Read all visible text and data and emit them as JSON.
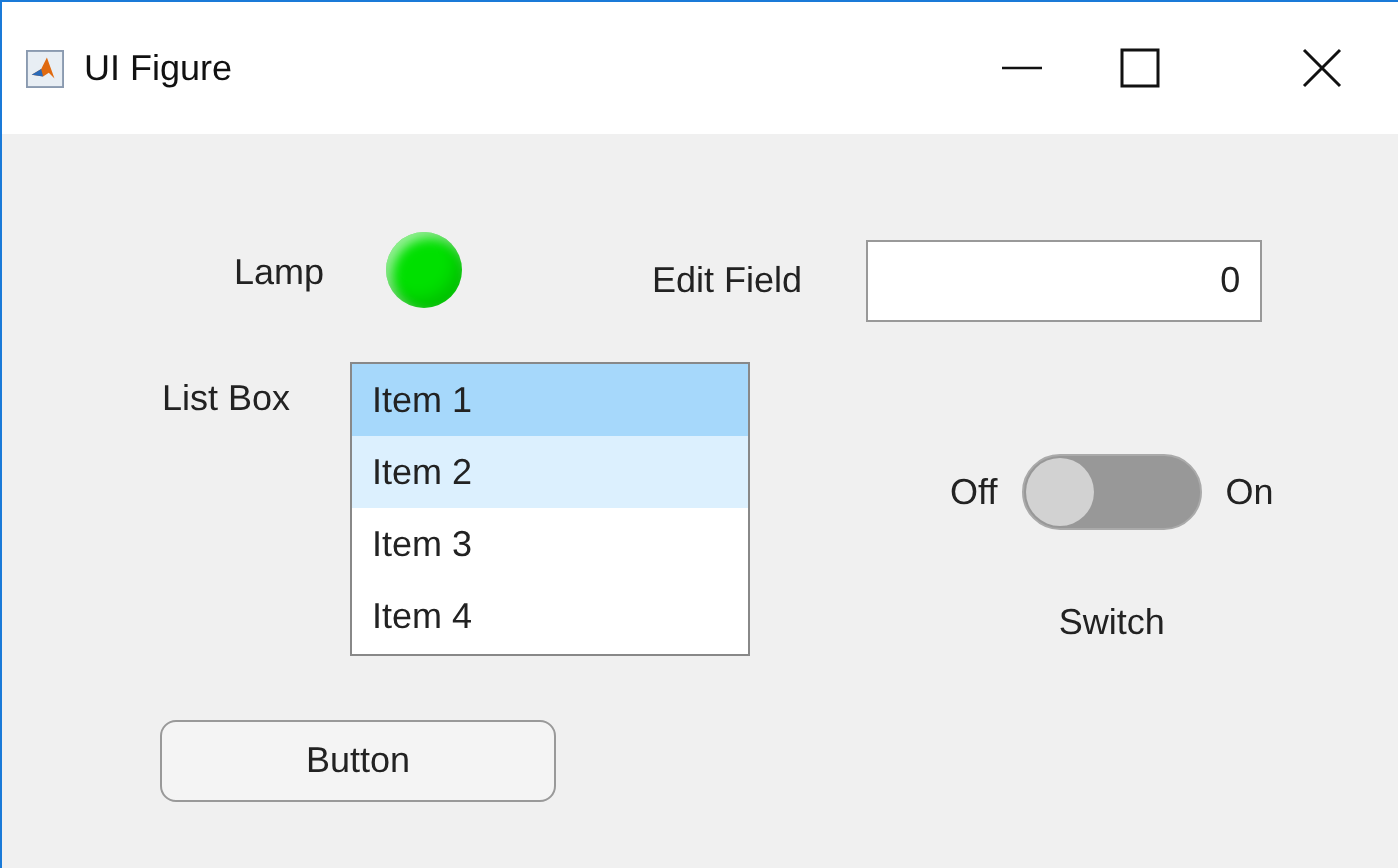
{
  "window": {
    "title": "UI Figure"
  },
  "lamp": {
    "label": "Lamp",
    "color": "#00e000"
  },
  "edit_field": {
    "label": "Edit Field",
    "value": "0"
  },
  "list_box": {
    "label": "List Box",
    "items": [
      {
        "label": "Item 1",
        "selected": true,
        "hovered": false
      },
      {
        "label": "Item 2",
        "selected": false,
        "hovered": true
      },
      {
        "label": "Item 3",
        "selected": false,
        "hovered": false
      },
      {
        "label": "Item 4",
        "selected": false,
        "hovered": false
      }
    ]
  },
  "switch": {
    "off_label": "Off",
    "on_label": "On",
    "label": "Switch",
    "on": false
  },
  "button": {
    "label": "Button"
  }
}
